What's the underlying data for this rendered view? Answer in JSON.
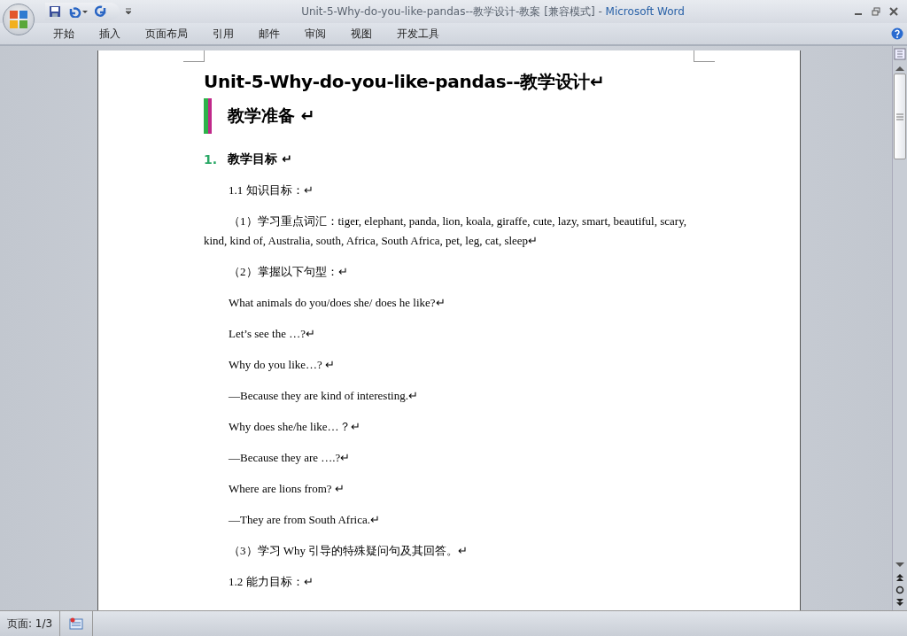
{
  "window": {
    "title": "Unit-5-Why-do-you-like-pandas--教学设计-教案 [兼容模式] - ",
    "app_name": "Microsoft Word"
  },
  "ribbon_tabs": [
    {
      "label": "开始",
      "selected": false
    },
    {
      "label": "插入",
      "selected": false
    },
    {
      "label": "页面布局",
      "selected": false
    },
    {
      "label": "引用",
      "selected": false
    },
    {
      "label": "邮件",
      "selected": false
    },
    {
      "label": "审阅",
      "selected": false
    },
    {
      "label": "视图",
      "selected": false
    },
    {
      "label": "开发工具",
      "selected": false
    }
  ],
  "document": [
    {
      "kind": "title",
      "text": "Unit-5-Why-do-you-like-pandas--教学设计↵"
    },
    {
      "kind": "heading",
      "text": "教学准备 ↵"
    },
    {
      "kind": "numbered",
      "number": "1.",
      "text": "教学目标 ↵"
    },
    {
      "kind": "para",
      "text": "1.1 知识目标：↵"
    },
    {
      "kind": "para",
      "text": "（1）学习重点词汇：tiger, elephant, panda, lion, koala, giraffe, cute, lazy, smart, beautiful, scary, kind, kind of, Australia, south, Africa, South Africa, pet, leg, cat, sleep↵"
    },
    {
      "kind": "para",
      "text": "（2）掌握以下句型：↵"
    },
    {
      "kind": "para",
      "text": "What animals do you/does she/  does he like?↵"
    },
    {
      "kind": "para",
      "text": "Let’s see the …?↵"
    },
    {
      "kind": "para",
      "text": "Why do you like…?  ↵"
    },
    {
      "kind": "para",
      "text": "—Because they are kind of interesting.↵"
    },
    {
      "kind": "para",
      "text": "Why does she/he like…？↵"
    },
    {
      "kind": "para",
      "text": "—Because they are ….?↵"
    },
    {
      "kind": "para",
      "text": "Where are lions from?  ↵"
    },
    {
      "kind": "para",
      "text": "—They are from South Africa.↵"
    },
    {
      "kind": "para",
      "text": "（3）学习 Why 引导的特殊疑问句及其回答。↵"
    },
    {
      "kind": "para",
      "text": "1.2 能力目标：↵"
    }
  ],
  "status_bar": {
    "page": "页面: 1/3"
  }
}
